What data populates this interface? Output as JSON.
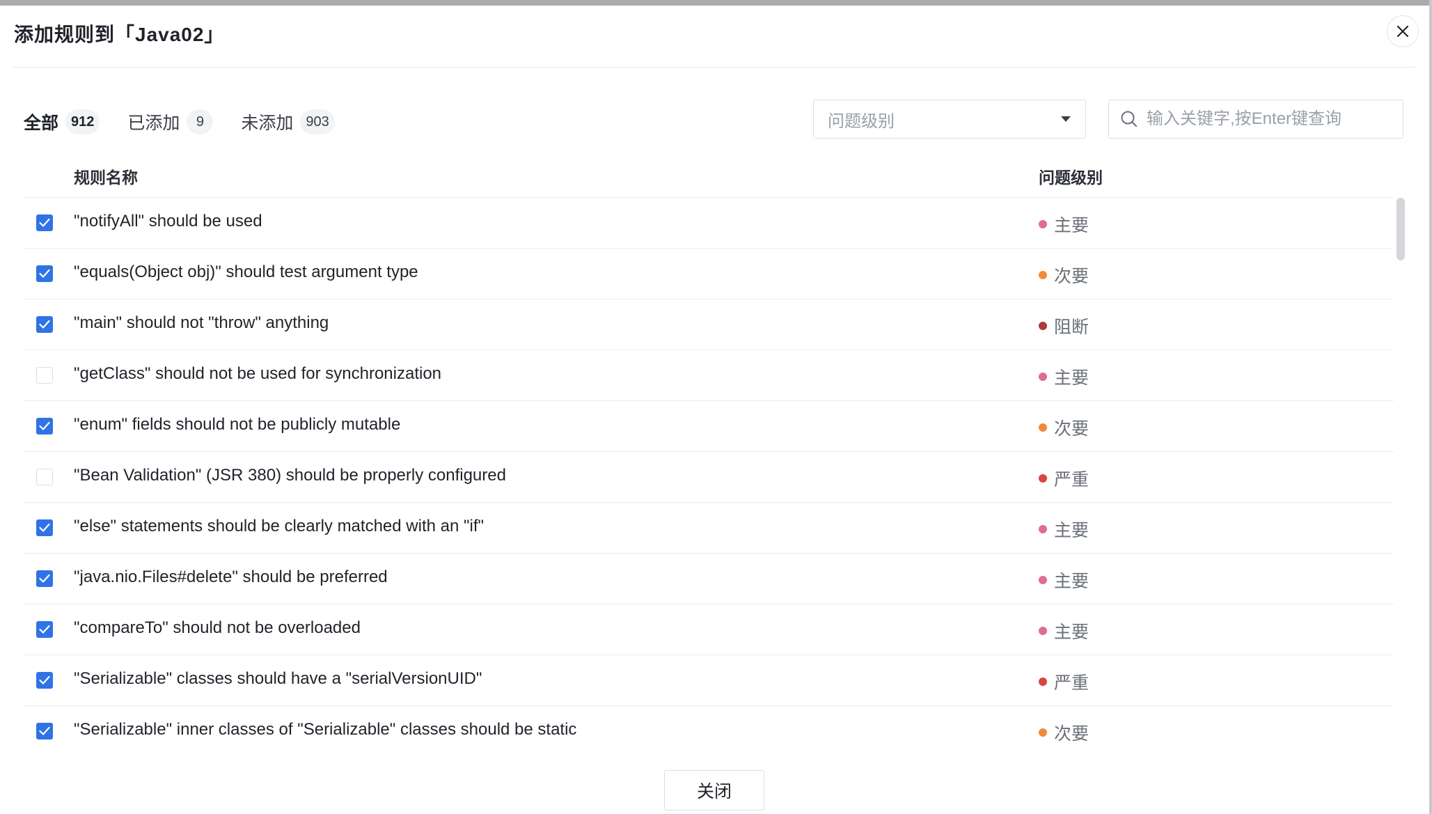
{
  "dialog": {
    "title": "添加规则到「Java02」",
    "close_button_label": "关闭"
  },
  "tabs": [
    {
      "label": "全部",
      "count": "912",
      "active": true
    },
    {
      "label": "已添加",
      "count": "9",
      "active": false
    },
    {
      "label": "未添加",
      "count": "903",
      "active": false
    }
  ],
  "filters": {
    "level_placeholder": "问题级别",
    "search_placeholder": "输入关键字,按Enter键查询"
  },
  "table": {
    "columns": {
      "name": "规则名称",
      "level": "问题级别"
    },
    "rows": [
      {
        "checked": true,
        "name": "\"notifyAll\" should be used",
        "level": "主要",
        "level_color": "#e06c8e"
      },
      {
        "checked": true,
        "name": "\"equals(Object obj)\" should test argument type",
        "level": "次要",
        "level_color": "#ef8a3c"
      },
      {
        "checked": true,
        "name": "\"main\" should not \"throw\" anything",
        "level": "阻断",
        "level_color": "#b03a3a"
      },
      {
        "checked": false,
        "name": "\"getClass\" should not be used for synchronization",
        "level": "主要",
        "level_color": "#e06c8e"
      },
      {
        "checked": true,
        "name": "\"enum\" fields should not be publicly mutable",
        "level": "次要",
        "level_color": "#ef8a3c"
      },
      {
        "checked": false,
        "name": "\"Bean Validation\" (JSR 380) should be properly configured",
        "level": "严重",
        "level_color": "#d9463f"
      },
      {
        "checked": true,
        "name": "\"else\" statements should be clearly matched with an \"if\"",
        "level": "主要",
        "level_color": "#e06c8e"
      },
      {
        "checked": true,
        "name": "\"java.nio.Files#delete\" should be preferred",
        "level": "主要",
        "level_color": "#e06c8e"
      },
      {
        "checked": true,
        "name": "\"compareTo\" should not be overloaded",
        "level": "主要",
        "level_color": "#e06c8e"
      },
      {
        "checked": true,
        "name": "\"Serializable\" classes should have a \"serialVersionUID\"",
        "level": "严重",
        "level_color": "#d9463f"
      },
      {
        "checked": true,
        "name": "\"Serializable\" inner classes of \"Serializable\" classes should be static",
        "level": "次要",
        "level_color": "#ef8a3c"
      }
    ]
  },
  "colors": {
    "checkbox_checked": "#2f73e6"
  }
}
